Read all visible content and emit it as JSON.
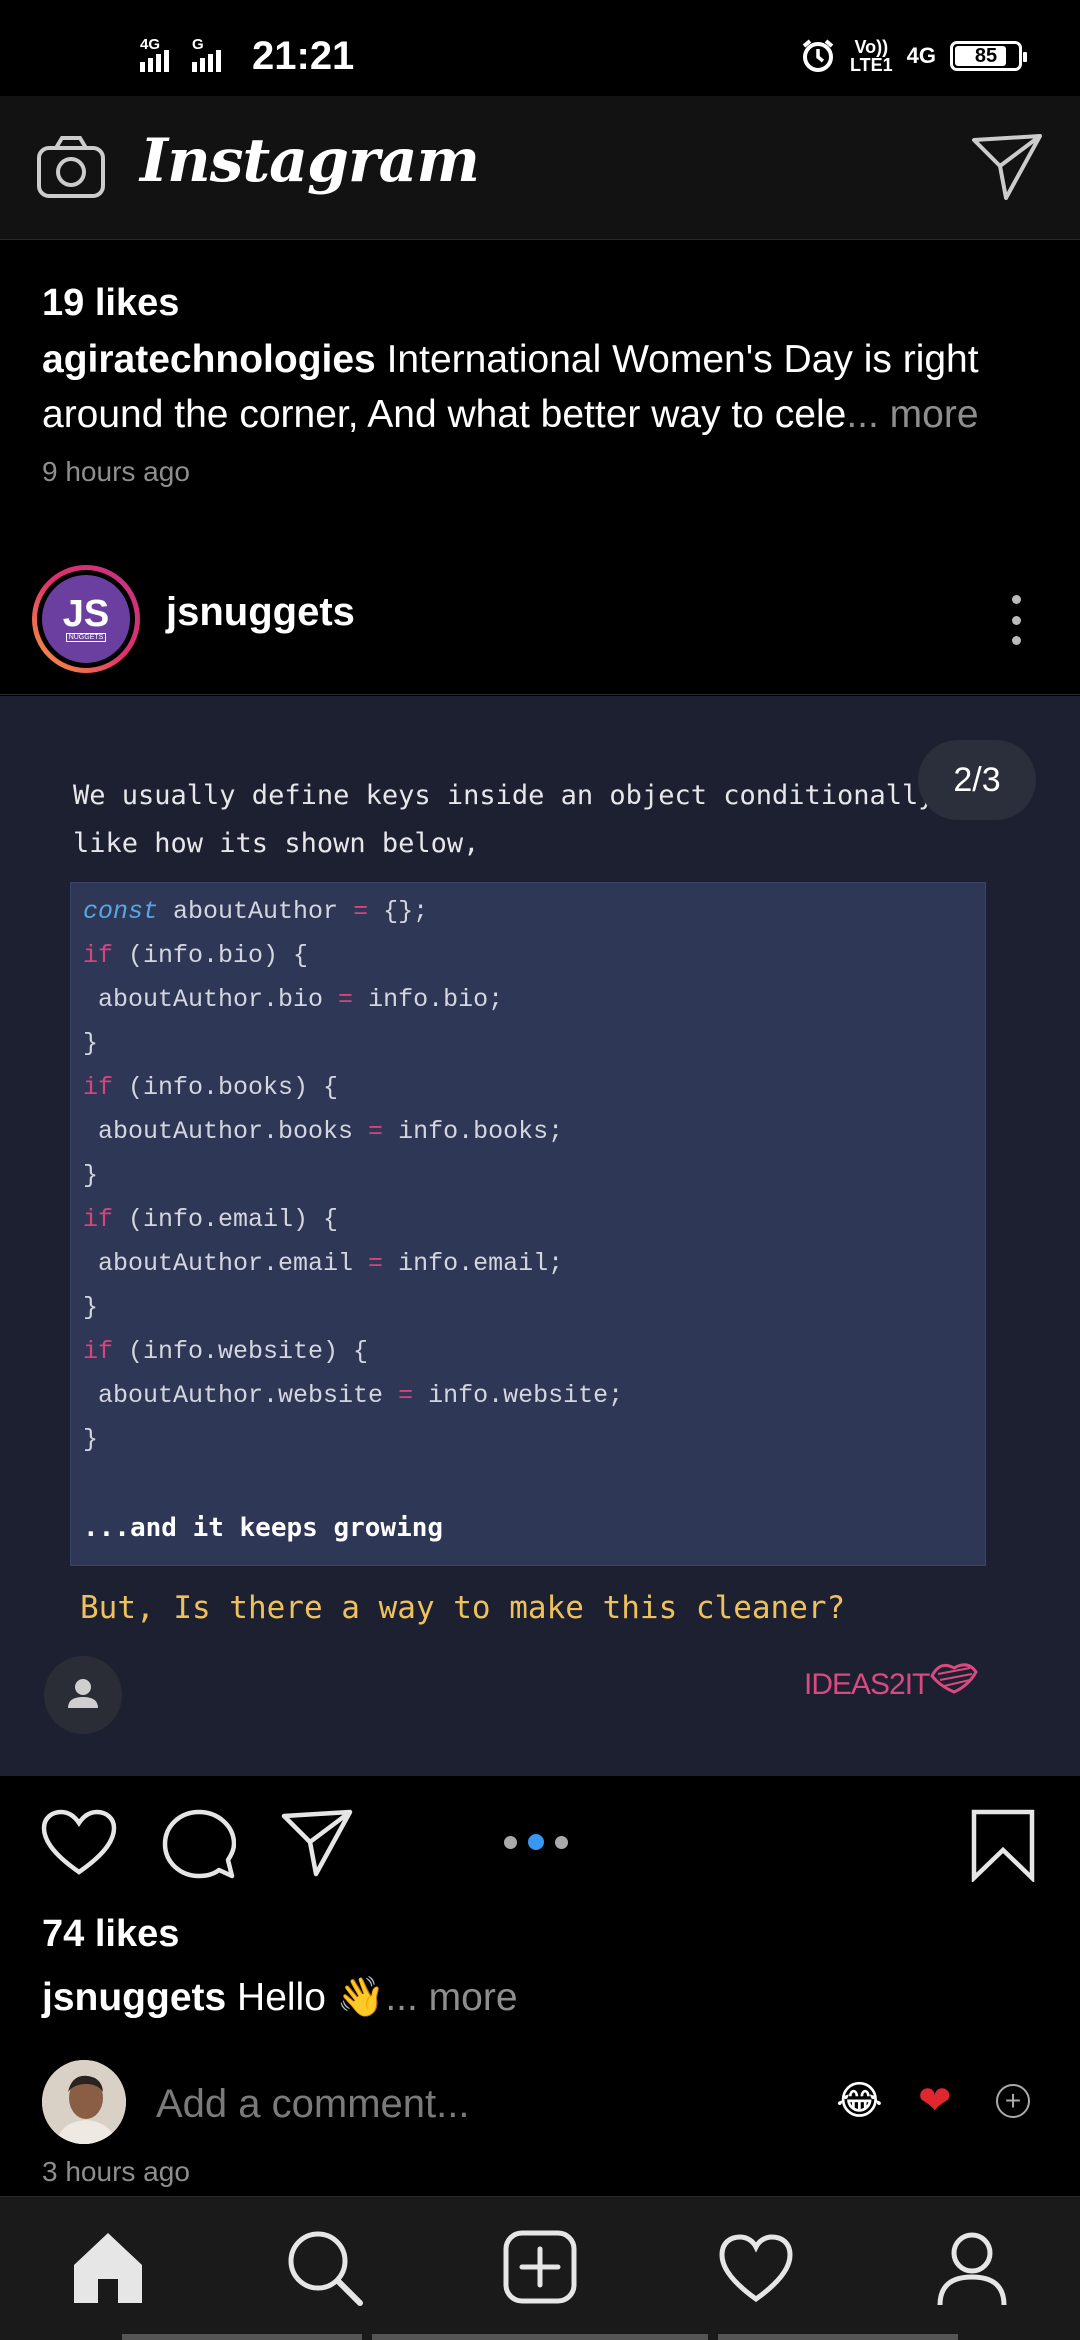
{
  "status_bar": {
    "network_left_1": "4G",
    "network_left_2": "G",
    "time": "21:21",
    "volte": "Vo))",
    "lte": "LTE1",
    "network_right": "4G",
    "battery": "85",
    "battery_level": 0.85
  },
  "header": {
    "app_title": "Instagram",
    "left_icon": "camera-icon",
    "right_icon": "direct-send-icon"
  },
  "previous_post": {
    "likes": "19 likes",
    "username": "agiratechnologies",
    "caption": "International Women's Day is right around the corner, And what better way to cele",
    "more": "... more",
    "time_ago": "9 hours ago"
  },
  "post": {
    "username": "jsnuggets",
    "avatar_text": "JS",
    "avatar_subtext": "NUGGETS",
    "slide_counter": "2/3",
    "slide_count": 3,
    "current_slide": 2,
    "image": {
      "intro_line1": "We usually define keys inside an object conditionally",
      "intro_line2": "like how its shown below,",
      "code": [
        {
          "kw": "const",
          "rest": " aboutAuthor ",
          "op": "=",
          "tail": " {};"
        },
        {
          "kw": "if",
          "rest": " (info.bio) {",
          "op": "",
          "tail": ""
        },
        {
          "kw": "",
          "rest": " aboutAuthor.bio ",
          "op": "=",
          "tail": " info.bio;"
        },
        {
          "kw": "",
          "rest": "}",
          "op": "",
          "tail": ""
        },
        {
          "kw": "if",
          "rest": " (info.books) {",
          "op": "",
          "tail": ""
        },
        {
          "kw": "",
          "rest": " aboutAuthor.books ",
          "op": "=",
          "tail": " info.books;"
        },
        {
          "kw": "",
          "rest": "}",
          "op": "",
          "tail": ""
        },
        {
          "kw": "if",
          "rest": " (info.email) {",
          "op": "",
          "tail": ""
        },
        {
          "kw": "",
          "rest": " aboutAuthor.email ",
          "op": "=",
          "tail": " info.email;"
        },
        {
          "kw": "",
          "rest": "}",
          "op": "",
          "tail": ""
        },
        {
          "kw": "if",
          "rest": " (info.website) {",
          "op": "",
          "tail": ""
        },
        {
          "kw": "",
          "rest": " aboutAuthor.website ",
          "op": "=",
          "tail": " info.website;"
        },
        {
          "kw": "",
          "rest": "}",
          "op": "",
          "tail": ""
        }
      ],
      "growing": "...and it keeps growing",
      "question": "But, Is there a way to make this cleaner?",
      "brand": "IDEAS2IT"
    },
    "likes": "74 likes",
    "caption_username": "jsnuggets",
    "caption": "Hello 👋",
    "more": "... more",
    "comment_placeholder": "Add a comment...",
    "quick_emoji_1": "😂",
    "quick_emoji_2": "❤",
    "time_ago": "3 hours ago"
  },
  "colors": {
    "background": "#000000",
    "header": "#121212",
    "slide_bg": "#1c2031",
    "code_bg": "#2f3756",
    "keyword": "#d7437d",
    "const_keyword": "#5aa6e2",
    "question": "#efc15a",
    "brand": "#d84a80",
    "active_dot": "#3897f0"
  },
  "bottom_nav": [
    "home-icon",
    "search-icon",
    "new-post-icon",
    "activity-heart-icon",
    "profile-icon"
  ]
}
